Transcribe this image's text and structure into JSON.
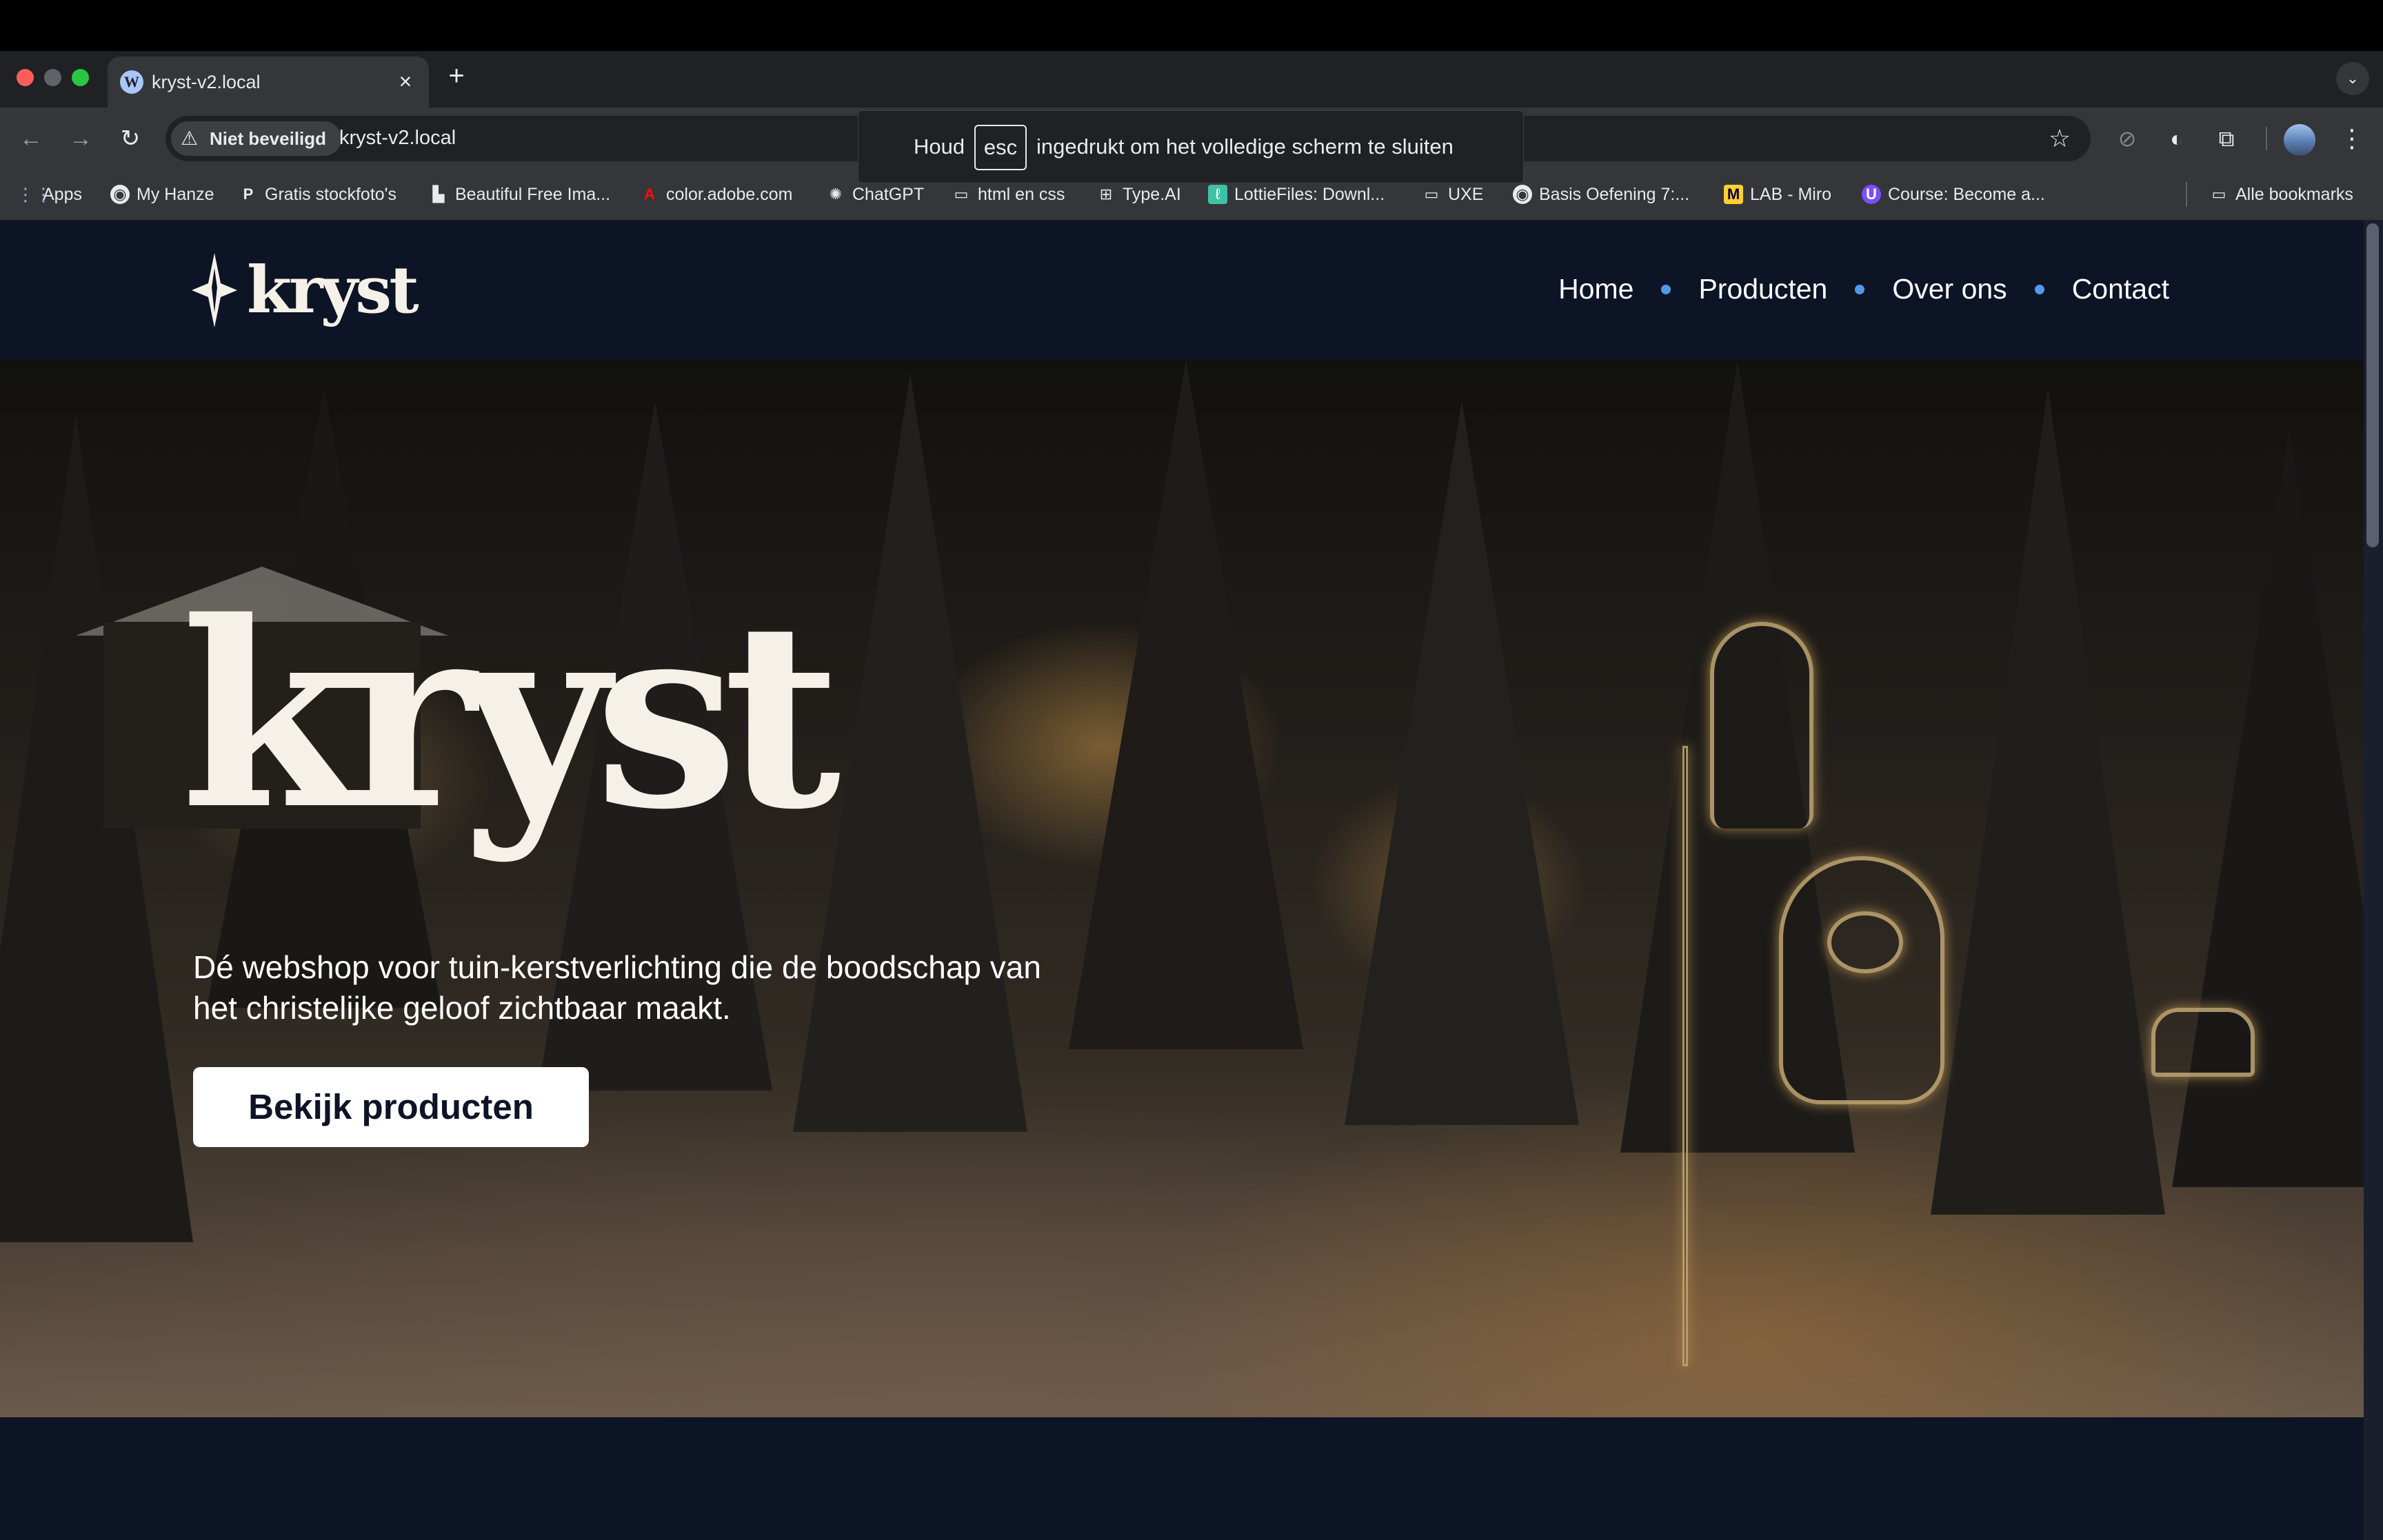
{
  "browser": {
    "tab": {
      "title": "kryst-v2.local",
      "close": "×"
    },
    "new_tab": "+",
    "tab_search": "⌄",
    "security_label": "Niet beveiligd",
    "url": "kryst-v2.local",
    "fullscreen_toast": {
      "before": "Houd",
      "key": "esc",
      "after": "ingedrukt om het volledige scherm te sluiten"
    },
    "bookmarks": [
      {
        "label": "Apps",
        "icon": "apps-grid-icon"
      },
      {
        "label": "My Hanze",
        "icon": "globe-icon"
      },
      {
        "label": "Gratis stockfoto's",
        "icon": "pexels-icon"
      },
      {
        "label": "Beautiful Free Ima...",
        "icon": "unsplash-icon"
      },
      {
        "label": "color.adobe.com",
        "icon": "adobe-icon"
      },
      {
        "label": "ChatGPT",
        "icon": "chatgpt-icon"
      },
      {
        "label": "html en css",
        "icon": "folder-icon"
      },
      {
        "label": "Type.AI",
        "icon": "typeai-icon"
      },
      {
        "label": "LottieFiles: Downl...",
        "icon": "lottie-icon"
      },
      {
        "label": "UXE",
        "icon": "folder-icon"
      },
      {
        "label": "Basis Oefening 7:...",
        "icon": "globe-icon"
      },
      {
        "label": "LAB - Miro",
        "icon": "miro-icon"
      },
      {
        "label": "Course: Become a...",
        "icon": "course-icon"
      }
    ],
    "other_bookmarks": "Alle bookmarks",
    "colors": {
      "chrome_dark": "#202124",
      "chrome_toolbar": "#35363a"
    }
  },
  "site": {
    "logo_text": "kryst",
    "nav": [
      "Home",
      "Producten",
      "Over ons",
      "Contact"
    ],
    "hero": {
      "title": "kryst",
      "subtitle": "Dé webshop voor tuin-kerstverlichting die de boodschap van het christelijke geloof zichtbaar maakt.",
      "cta": "Bekijk producten"
    },
    "colors": {
      "navy": "#0d1426",
      "cream": "#f5f1e8",
      "nav_dot": "#4f9be8"
    }
  }
}
